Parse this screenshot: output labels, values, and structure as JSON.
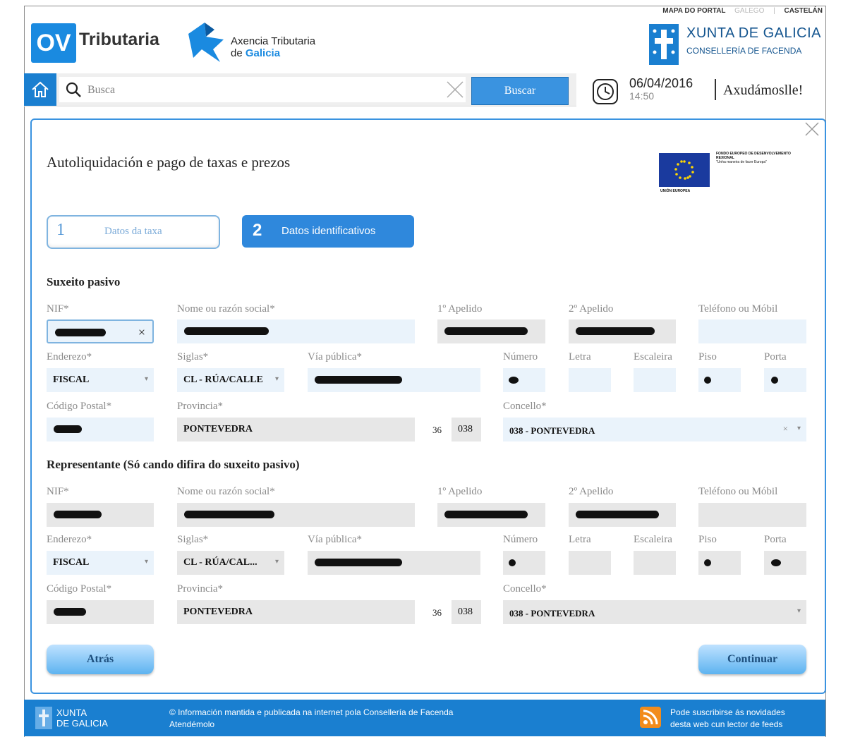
{
  "header": {
    "links": {
      "map": "MAPA DO PORTAL",
      "galego": "GALEGO",
      "sep": "|",
      "castelan": "CASTELÁN"
    },
    "ov_logo": "OV",
    "ov_text": "Tributaria",
    "atg_line1": "Axencia Tributaria",
    "atg_line2a": "de ",
    "atg_line2b": "Galicia",
    "xunta_title": "XUNTA DE GALICIA",
    "xunta_sub": "CONSELLERÍA DE FACENDA"
  },
  "search": {
    "placeholder": "Busca",
    "button": "Buscar"
  },
  "datetime": {
    "date": "06/04/2016",
    "time": "14:50"
  },
  "help": "Axudámoslle!",
  "modal": {
    "title": "Autoliquidación e pago de taxas e prezos",
    "eu_label": "UNIÓN EUROPEA",
    "eu_text": "FONDO EUROPEO DE DESENVOLVEMENTO REXIONAL",
    "eu_motto": "\"Unha maneira de facer Europa\"",
    "steps": [
      {
        "num": "1",
        "label": "Datos da taxa"
      },
      {
        "num": "2",
        "label": "Datos identificativos"
      }
    ]
  },
  "suxeito": {
    "title": "Suxeito pasivo",
    "labels": {
      "nif": "NIF*",
      "nome": "Nome ou razón social*",
      "ap1": "1º Apelido",
      "ap2": "2º Apelido",
      "tel": "Teléfono ou Móbil",
      "enderezo": "Enderezo*",
      "siglas": "Siglas*",
      "via": "Vía pública*",
      "numero": "Número",
      "letra": "Letra",
      "escaleira": "Escaleira",
      "piso": "Piso",
      "porta": "Porta",
      "cp": "Código Postal*",
      "provincia": "Provincia*",
      "concello": "Concello*"
    },
    "values": {
      "enderezo": "FISCAL",
      "siglas": "CL - RÚA/CALLE",
      "provincia": "PONTEVEDRA",
      "prov_code": "36",
      "conc_code": "038",
      "concello": "038 - PONTEVEDRA"
    }
  },
  "representante": {
    "title": "Representante (Só cando difira do suxeito pasivo)",
    "labels": {
      "nif": "NIF*",
      "nome": "Nome ou razón social*",
      "ap1": "1º Apelido",
      "ap2": "2º Apelido",
      "tel": "Teléfono ou Móbil",
      "enderezo": "Enderezo*",
      "siglas": "Siglas*",
      "via": "Vía pública*",
      "numero": "Número",
      "letra": "Letra",
      "escaleira": "Escaleira",
      "piso": "Piso",
      "porta": "Porta",
      "cp": "Código Postal*",
      "provincia": "Provincia*",
      "concello": "Concello*"
    },
    "values": {
      "enderezo": "FISCAL",
      "siglas": "CL - RÚA/CAL...",
      "provincia": "PONTEVEDRA",
      "prov_code": "36",
      "conc_code": "038",
      "concello": "038 - PONTEVEDRA"
    }
  },
  "buttons": {
    "back": "Atrás",
    "continue": "Continuar"
  },
  "footer": {
    "xunta_line1": "XUNTA",
    "xunta_line2": "DE GALICIA",
    "info_line1": "© Información mantida e publicada na internet pola Consellería de Facenda",
    "info_line2": "Atendémolo",
    "rss_line1": "Pode suscribirse ás novidades",
    "rss_line2": "desta web cun lector de feeds"
  },
  "colors": {
    "accent": "#1a7fd0",
    "button_blue": "#3a93e0",
    "field_edit": "#eaf3fb",
    "field_read": "#e7e7e7"
  }
}
